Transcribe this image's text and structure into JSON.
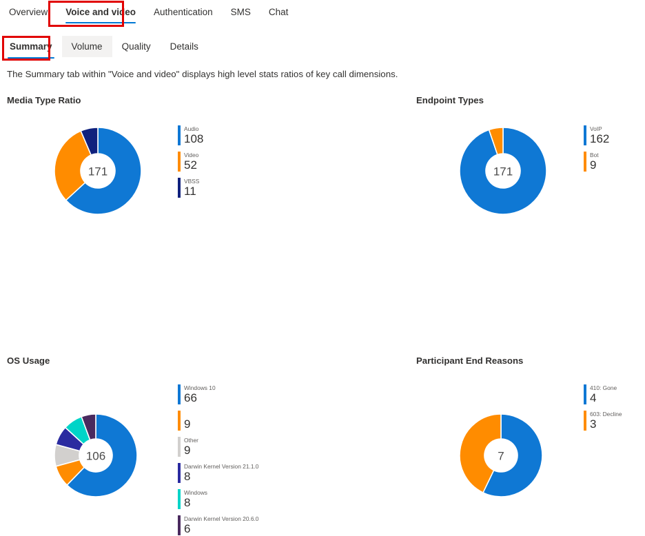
{
  "topnav": {
    "items": [
      {
        "label": "Overview",
        "selected": false
      },
      {
        "label": "Voice and video",
        "selected": true
      },
      {
        "label": "Authentication",
        "selected": false
      },
      {
        "label": "SMS",
        "selected": false
      },
      {
        "label": "Chat",
        "selected": false
      }
    ]
  },
  "subnav": {
    "items": [
      {
        "label": "Summary",
        "selected": true,
        "hovered": false
      },
      {
        "label": "Volume",
        "selected": false,
        "hovered": true
      },
      {
        "label": "Quality",
        "selected": false,
        "hovered": false
      },
      {
        "label": "Details",
        "selected": false,
        "hovered": false
      }
    ]
  },
  "description": "The Summary tab within \"Voice and video\" displays high level stats ratios of key call dimensions.",
  "annotations": [
    {
      "name": "highlight-voice-and-video-tab",
      "color": "#e10000"
    },
    {
      "name": "highlight-summary-tab",
      "color": "#e10000"
    }
  ],
  "palette": {
    "blue": "#0f78d4",
    "orange": "#ff8c00",
    "navy": "#10217d",
    "gray": "#d2d0ce",
    "indigo": "#2b2ba0",
    "teal": "#00d4c8",
    "purple": "#4a2a5e",
    "accent": "#0078d4",
    "annotation": "#e10000"
  },
  "chart_data": [
    {
      "type": "pie",
      "name": "media-type-ratio",
      "title": "Media Type Ratio",
      "center_label": "171",
      "total": 171,
      "legend_position": "right",
      "categories": [
        "Audio",
        "Video",
        "VBSS"
      ],
      "values": [
        108,
        52,
        11
      ],
      "colors": [
        "#0f78d4",
        "#ff8c00",
        "#10217d"
      ]
    },
    {
      "type": "pie",
      "name": "endpoint-types",
      "title": "Endpoint Types",
      "center_label": "171",
      "total": 171,
      "legend_position": "right",
      "categories": [
        "VoIP",
        "Bot"
      ],
      "values": [
        162,
        9
      ],
      "colors": [
        "#0f78d4",
        "#ff8c00"
      ]
    },
    {
      "type": "pie",
      "name": "os-usage",
      "title": "OS Usage",
      "center_label": "106",
      "total": 106,
      "legend_position": "right",
      "categories": [
        "Windows 10",
        "",
        "Other",
        "Darwin Kernel Version 21.1.0",
        "Windows",
        "Darwin Kernel Version 20.6.0"
      ],
      "values": [
        66,
        9,
        9,
        8,
        8,
        6
      ],
      "colors": [
        "#0f78d4",
        "#ff8c00",
        "#d2d0ce",
        "#2b2ba0",
        "#00d4c8",
        "#4a2a5e"
      ]
    },
    {
      "type": "pie",
      "name": "participant-end-reasons",
      "title": "Participant End Reasons",
      "center_label": "7",
      "total": 7,
      "legend_position": "right",
      "categories": [
        "410: Gone",
        "603: Decline"
      ],
      "values": [
        4,
        3
      ],
      "colors": [
        "#0f78d4",
        "#ff8c00"
      ]
    }
  ]
}
